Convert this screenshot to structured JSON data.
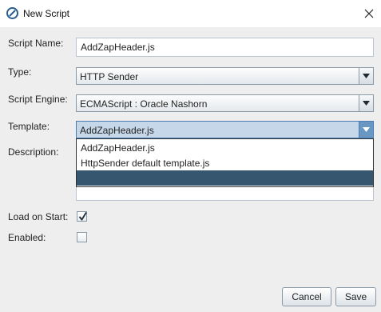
{
  "window": {
    "title": "New Script"
  },
  "form": {
    "script_name": {
      "label": "Script Name:",
      "value": "AddZapHeader.js"
    },
    "type": {
      "label": "Type:",
      "selected": "HTTP Sender"
    },
    "script_engine": {
      "label": "Script Engine:",
      "selected": "ECMAScript : Oracle Nashorn"
    },
    "template": {
      "label": "Template:",
      "selected": "AddZapHeader.js",
      "options": [
        "AddZapHeader.js",
        "HttpSender default template.js",
        ""
      ]
    },
    "description": {
      "label": "Description:",
      "value": ""
    },
    "load_on_start": {
      "label": "Load on Start:",
      "checked": true
    },
    "enabled": {
      "label": "Enabled:",
      "checked": false
    }
  },
  "buttons": {
    "cancel": "Cancel",
    "save": "Save"
  },
  "colors": {
    "accent": "#4b7fb3",
    "selection": "#36556f",
    "background": "#eeeeee"
  },
  "icons": {
    "app": "zap-logo-icon",
    "close": "close-icon",
    "dropdown": "triangle-down-icon",
    "check": "checkmark-icon"
  }
}
